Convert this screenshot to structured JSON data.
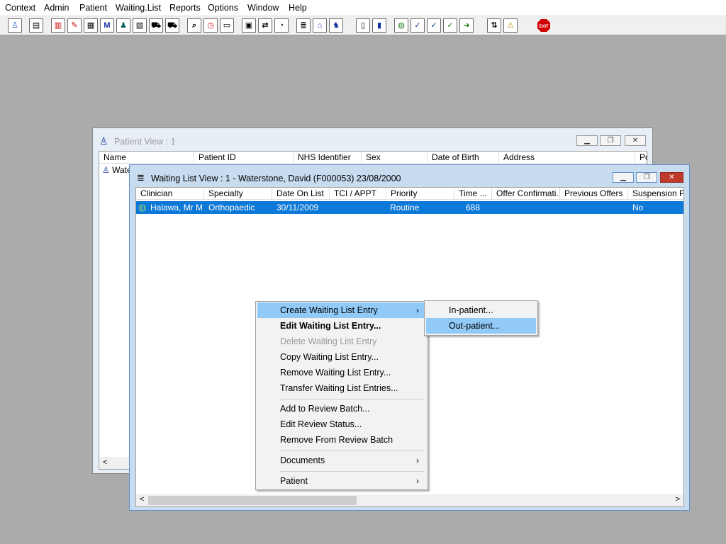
{
  "menubar": {
    "items": [
      "Context",
      "Admin",
      "Patient",
      "Waiting.List",
      "Reports",
      "Options",
      "Window",
      "Help"
    ]
  },
  "toolbar": {
    "exit_label": "EXIT"
  },
  "patient_view": {
    "title": "Patient View : 1",
    "columns": [
      "Name",
      "Patient ID",
      "NHS Identifier",
      "Sex",
      "Date of Birth",
      "Address",
      "Po"
    ],
    "row_name": "Wate"
  },
  "waiting_list_view": {
    "title": "Waiting List View :  1 - Waterstone, David (F000053) 23/08/2000",
    "columns": [
      "Clinician",
      "Specialty",
      "Date On List",
      "TCI / APPT",
      "Priority",
      "Time ...",
      "Offer Confirmati...",
      "Previous Offers",
      "Suspension Pe"
    ],
    "rows": [
      {
        "clinician": "Halawa, Mr M",
        "specialty": "Orthopaedic",
        "date_on_list": "30/11/2009",
        "tci_appt": "",
        "priority": "Routine",
        "time": "688",
        "offer_confirmation": "",
        "previous_offers": "",
        "suspension": "No"
      }
    ]
  },
  "context_menu": {
    "items": [
      {
        "label": "Create Waiting List Entry",
        "submenu": true
      },
      {
        "label": "Edit Waiting List Entry..."
      },
      {
        "label": "Delete Waiting List Entry"
      },
      {
        "label": "Copy Waiting List Entry..."
      },
      {
        "label": "Remove Waiting List Entry..."
      },
      {
        "label": "Transfer Waiting List Entries..."
      },
      {
        "label": "Add to Review Batch..."
      },
      {
        "label": "Edit Review Status..."
      },
      {
        "label": "Remove From Review Batch"
      },
      {
        "label": "Documents",
        "submenu": true
      },
      {
        "label": "Patient",
        "submenu": true
      }
    ]
  },
  "submenu": {
    "items": [
      "In-patient...",
      "Out-patient..."
    ]
  },
  "colors": {
    "selection": "#0c78d8",
    "menu_highlight": "#91c9f7",
    "desktop": "#ababab"
  }
}
